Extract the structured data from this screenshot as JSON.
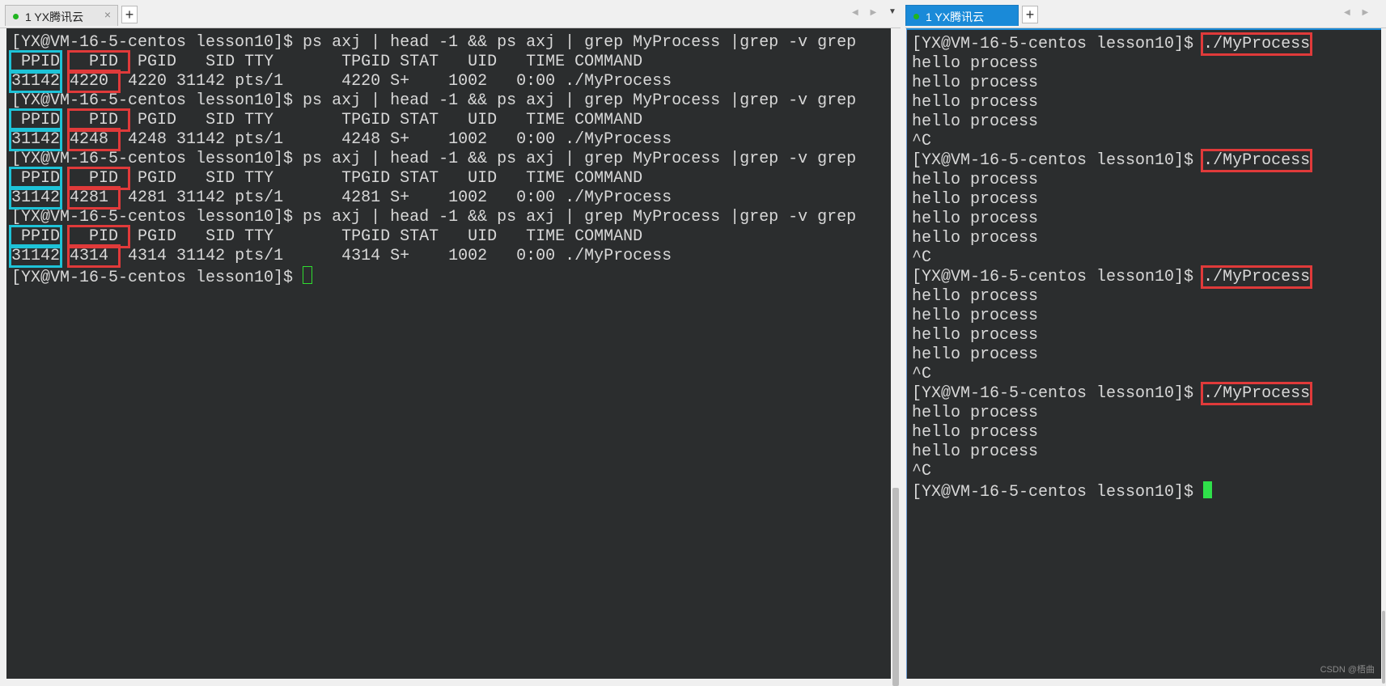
{
  "left_pane": {
    "tab": {
      "label": "1 YX腾讯云",
      "close": "×"
    },
    "newtab": "+",
    "nav": "◀ ▶",
    "dropdown": "▼",
    "lines": [
      {
        "pre": "[YX@VM-16-5-centos lesson10]$ ps axj | head -1 && ps axj | grep MyProcess |grep -v grep"
      },
      {
        "ppid": " PPID",
        "gap": " ",
        "pid": "  PID ",
        "rest": " PGID   SID TTY       TPGID STAT   UID   TIME COMMAND"
      },
      {
        "ppid": "31142",
        "gap": " ",
        "pid": "4220 ",
        "rest": " 4220 31142 pts/1      4220 S+    1002   0:00 ./MyProcess"
      },
      {
        "pre": "[YX@VM-16-5-centos lesson10]$ ps axj | head -1 && ps axj | grep MyProcess |grep -v grep"
      },
      {
        "ppid": " PPID",
        "gap": " ",
        "pid": "  PID ",
        "rest": " PGID   SID TTY       TPGID STAT   UID   TIME COMMAND"
      },
      {
        "ppid": "31142",
        "gap": " ",
        "pid": "4248 ",
        "rest": " 4248 31142 pts/1      4248 S+    1002   0:00 ./MyProcess"
      },
      {
        "pre": "[YX@VM-16-5-centos lesson10]$ ps axj | head -1 && ps axj | grep MyProcess |grep -v grep"
      },
      {
        "ppid": " PPID",
        "gap": " ",
        "pid": "  PID ",
        "rest": " PGID   SID TTY       TPGID STAT   UID   TIME COMMAND"
      },
      {
        "ppid": "31142",
        "gap": " ",
        "pid": "4281 ",
        "rest": " 4281 31142 pts/1      4281 S+    1002   0:00 ./MyProcess"
      },
      {
        "pre": "[YX@VM-16-5-centos lesson10]$ ps axj | head -1 && ps axj | grep MyProcess |grep -v grep"
      },
      {
        "ppid": " PPID",
        "gap": " ",
        "pid": "  PID ",
        "rest": " PGID   SID TTY       TPGID STAT   UID   TIME COMMAND"
      },
      {
        "ppid": "31142",
        "gap": " ",
        "pid": "4314 ",
        "rest": " 4314 31142 pts/1      4314 S+    1002   0:00 ./MyProcess"
      },
      {
        "pre": "[YX@VM-16-5-centos lesson10]$ ",
        "cursor": "box"
      }
    ]
  },
  "right_pane": {
    "tab": {
      "label": "1 YX腾讯云"
    },
    "newtab": "+",
    "nav": "◀ ▶",
    "lines": [
      {
        "pre": "[YX@VM-16-5-centos lesson10]$ ",
        "cmd": "./MyProcess"
      },
      {
        "pre": "hello process"
      },
      {
        "pre": "hello process"
      },
      {
        "pre": "hello process"
      },
      {
        "pre": "hello process"
      },
      {
        "pre": "^C"
      },
      {
        "pre": "[YX@VM-16-5-centos lesson10]$ ",
        "cmd": "./MyProcess"
      },
      {
        "pre": "hello process"
      },
      {
        "pre": "hello process"
      },
      {
        "pre": "hello process"
      },
      {
        "pre": "hello process"
      },
      {
        "pre": "^C"
      },
      {
        "pre": "[YX@VM-16-5-centos lesson10]$ ",
        "cmd": "./MyProcess"
      },
      {
        "pre": "hello process"
      },
      {
        "pre": "hello process"
      },
      {
        "pre": "hello process"
      },
      {
        "pre": "hello process"
      },
      {
        "pre": "^C"
      },
      {
        "pre": "[YX@VM-16-5-centos lesson10]$ ",
        "cmd": "./MyProcess"
      },
      {
        "pre": "hello process"
      },
      {
        "pre": "hello process"
      },
      {
        "pre": "hello process"
      },
      {
        "pre": "^C"
      },
      {
        "pre": "[YX@VM-16-5-centos lesson10]$ ",
        "cursor": "block"
      }
    ]
  },
  "watermark": "CSDN @梧曲",
  "colors": {
    "terminal_bg": "#2b2d2e",
    "terminal_fg": "#d8d8d8",
    "highlight_cyan": "#1ec3d8",
    "highlight_red": "#e03a3a",
    "cursor_green": "#2fe04a",
    "active_tab": "#1a8ad8"
  }
}
